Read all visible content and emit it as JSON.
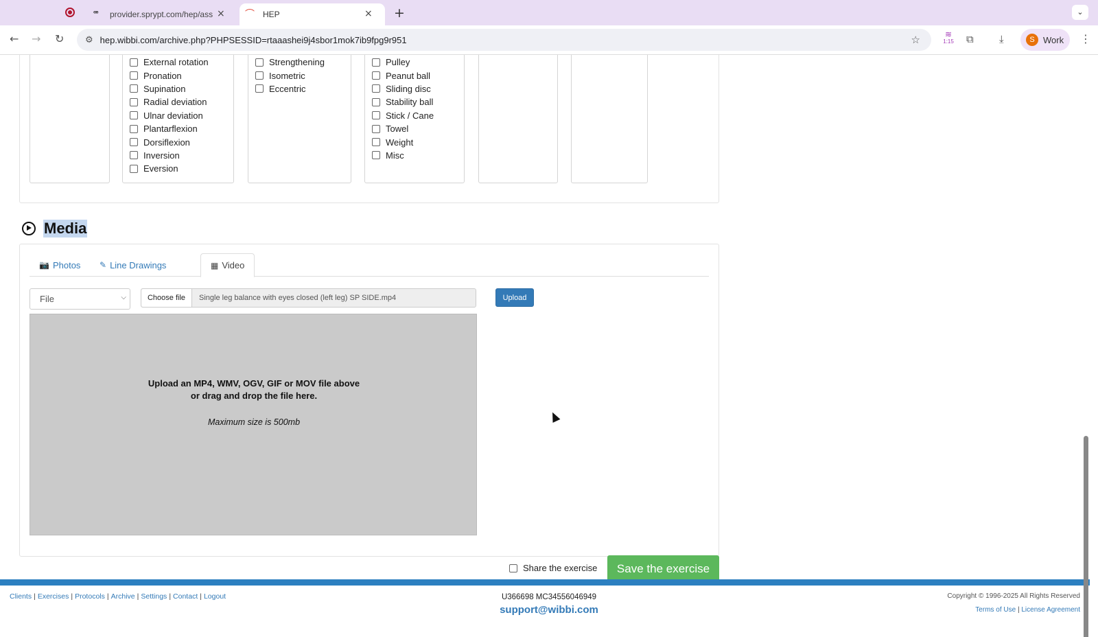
{
  "browser": {
    "tabs": [
      {
        "title": "provider.sprypt.com/hep/assi",
        "favicon": "sprypt-icon"
      },
      {
        "title": "HEP",
        "favicon": "hep-icon"
      }
    ],
    "url": "hep.wibbi.com/archive.php?PHPSESSID=rtaaashei9j4sbor1mok7ib9fpg9r951",
    "extension_badge": "1:15",
    "profile_initial": "S",
    "profile_label": "Work"
  },
  "filters": {
    "movement": [
      "External rotation",
      "Pronation",
      "Supination",
      "Radial deviation",
      "Ulnar deviation",
      "Plantarflexion",
      "Dorsiflexion",
      "Inversion",
      "Eversion"
    ],
    "contraction": [
      "Strengthening",
      "Isometric",
      "Eccentric"
    ],
    "equipment": [
      "Pulley",
      "Peanut ball",
      "Sliding disc",
      "Stability ball",
      "Stick / Cane",
      "Towel",
      "Weight",
      "Misc"
    ]
  },
  "media": {
    "heading": "Media",
    "tabs": {
      "photos": "Photos",
      "line_drawings": "Line Drawings",
      "video": "Video"
    },
    "active_tab": "Video",
    "source_select": "File",
    "choose_file_label": "Choose file",
    "file_name": "Single leg balance with eyes closed (left leg) SP SIDE.mp4",
    "upload_label": "Upload",
    "dropzone_line1": "Upload an MP4, WMV, OGV, GIF or MOV file above",
    "dropzone_line2": "or drag and drop the file here.",
    "dropzone_max": "Maximum size is 500mb"
  },
  "actions": {
    "share_label": "Share the exercise",
    "save_label": "Save the exercise"
  },
  "footer": {
    "links": [
      "Clients",
      "Exercises",
      "Protocols",
      "Archive",
      "Settings",
      "Contact",
      "Logout"
    ],
    "ids": "U366698 MC34556046949",
    "email": "support@wibbi.com",
    "copyright": "Copyright © 1996-2025 All Rights Reserved",
    "terms": "Terms of Use",
    "license": "License Agreement"
  },
  "colors": {
    "link": "#337ab7",
    "save_green": "#5cb85c",
    "footer_bar": "#2c7fc0",
    "tabbar_bg": "#e9ddf4"
  }
}
